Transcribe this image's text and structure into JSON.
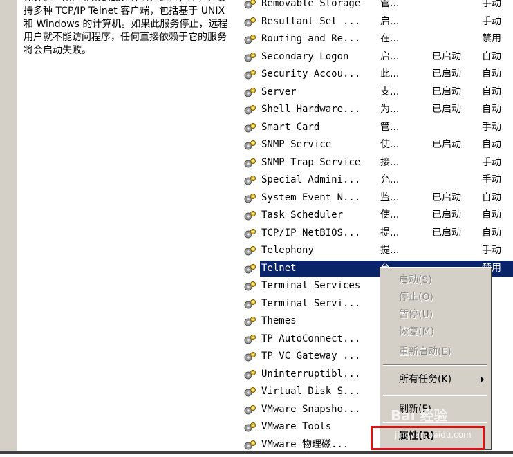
{
  "description": "允许远程用户登录到此计算机并运行程序，并支持多种 TCP/IP Telnet 客户端，包括基于 UNIX 和 Windows 的计算机。如果此服务停止，远程用户就不能访问程序，任何直接依赖于它的服务将会启动失败。",
  "services": [
    {
      "name": "Removable Storage",
      "desc": "管...",
      "status": "",
      "startup": "手动"
    },
    {
      "name": "Resultant Set ...",
      "desc": "启...",
      "status": "",
      "startup": "手动"
    },
    {
      "name": "Routing and Re...",
      "desc": "在...",
      "status": "",
      "startup": "禁用"
    },
    {
      "name": "Secondary Logon",
      "desc": "启...",
      "status": "已启动",
      "startup": "自动"
    },
    {
      "name": "Security Accou...",
      "desc": "此...",
      "status": "已启动",
      "startup": "自动"
    },
    {
      "name": "Server",
      "desc": "支...",
      "status": "已启动",
      "startup": "自动"
    },
    {
      "name": "Shell Hardware...",
      "desc": "为...",
      "status": "已启动",
      "startup": "自动"
    },
    {
      "name": "Smart Card",
      "desc": "管...",
      "status": "",
      "startup": "手动"
    },
    {
      "name": "SNMP Service",
      "desc": "使...",
      "status": "已启动",
      "startup": "自动"
    },
    {
      "name": "SNMP Trap Service",
      "desc": "接...",
      "status": "",
      "startup": "手动"
    },
    {
      "name": "Special Admini...",
      "desc": "允...",
      "status": "",
      "startup": "手动"
    },
    {
      "name": "System Event N...",
      "desc": "监...",
      "status": "已启动",
      "startup": "自动"
    },
    {
      "name": "Task Scheduler",
      "desc": "使...",
      "status": "已启动",
      "startup": "自动"
    },
    {
      "name": "TCP/IP NetBIOS...",
      "desc": "提...",
      "status": "已启动",
      "startup": "自动"
    },
    {
      "name": "Telephony",
      "desc": "提...",
      "status": "",
      "startup": "手动"
    },
    {
      "name": "Telnet",
      "desc": "允",
      "status": "",
      "startup": "禁用"
    },
    {
      "name": "Terminal Services",
      "desc": "",
      "status": "",
      "startup": "动"
    },
    {
      "name": "Terminal Servi...",
      "desc": "",
      "status": "",
      "startup": "用"
    },
    {
      "name": "Themes",
      "desc": "",
      "status": "",
      "startup": "用"
    },
    {
      "name": "TP AutoConnect...",
      "desc": "",
      "status": "",
      "startup": "动"
    },
    {
      "name": "TP VC Gateway ...",
      "desc": "",
      "status": "",
      "startup": "动"
    },
    {
      "name": "Uninterruptibl...",
      "desc": "",
      "status": "",
      "startup": "动"
    },
    {
      "name": "Virtual Disk S...",
      "desc": "",
      "status": "",
      "startup": "动"
    },
    {
      "name": "VMware Snapsho...",
      "desc": "",
      "status": "",
      "startup": "动"
    },
    {
      "name": "VMware Tools",
      "desc": "",
      "status": "",
      "startup": "动"
    },
    {
      "name": "VMware 物理磁...",
      "desc": "",
      "status": "",
      "startup": "动"
    }
  ],
  "context_menu": {
    "start": "启动(S)",
    "stop": "停止(O)",
    "pause": "暂停(U)",
    "resume": "恢复(M)",
    "restart": "重新启动(E)",
    "all_tasks": "所有任务(K)",
    "refresh": "刷新(F)",
    "properties": "属性(R)"
  },
  "watermark": {
    "brand": "Bai 经验",
    "url": "jingyan.baidu.com"
  },
  "colors": {
    "selection": "#0a246a",
    "menu_bg": "#d4d0c8",
    "highlight_box": "#e01010"
  }
}
